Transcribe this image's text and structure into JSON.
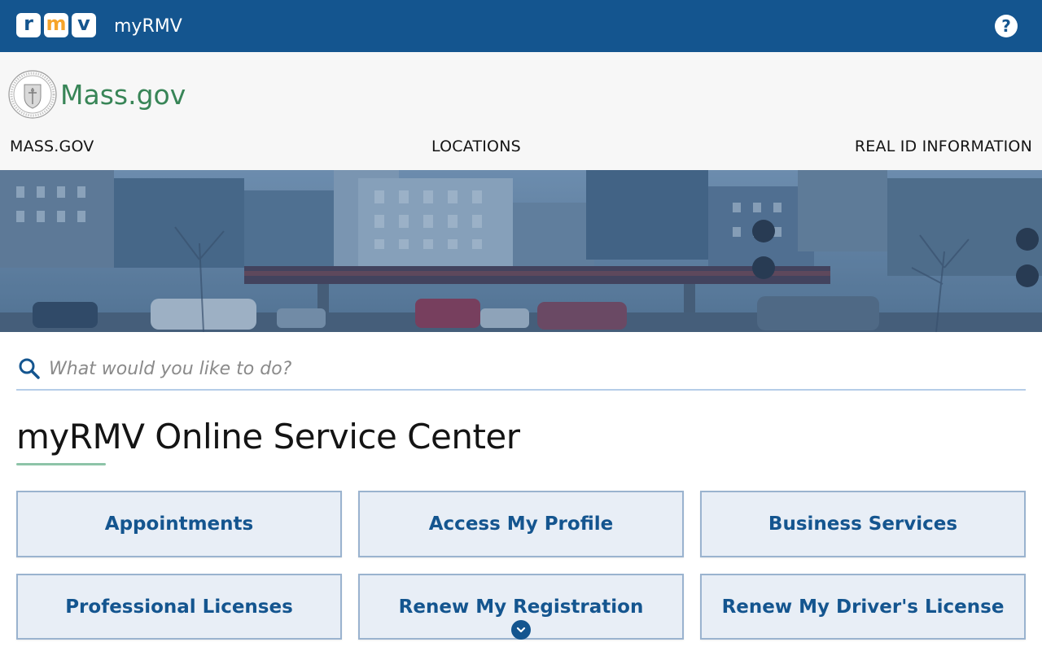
{
  "topbar": {
    "logo_letters": [
      "r",
      "m",
      "v"
    ],
    "app_name": "myRMV",
    "help_label": "?",
    "background_color": "#14558f"
  },
  "mass_header": {
    "logo_text": "Mass.gov",
    "nav": [
      {
        "label": "MASS.GOV"
      },
      {
        "label": "LOCATIONS"
      },
      {
        "label": "REAL ID INFORMATION"
      }
    ]
  },
  "search": {
    "placeholder": "What would you like to do?",
    "value": "",
    "icon": "search-icon"
  },
  "main": {
    "title": "myRMV Online Service Center",
    "services": [
      {
        "label": "Appointments"
      },
      {
        "label": "Access My Profile"
      },
      {
        "label": "Business Services"
      },
      {
        "label": "Professional Licenses"
      },
      {
        "label": "Renew My Registration"
      },
      {
        "label": "Renew My Driver's License"
      }
    ]
  },
  "colors": {
    "primary_blue": "#14558f",
    "logo_orange": "#f6a42a",
    "mass_green": "#388557",
    "tile_background": "#e8eef6"
  }
}
